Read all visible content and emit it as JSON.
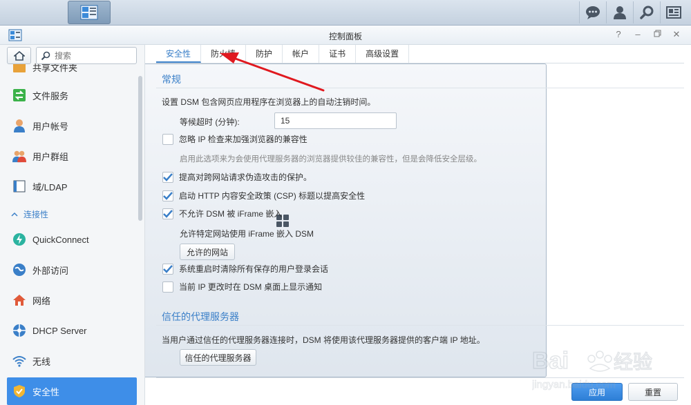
{
  "window": {
    "title": "控制面板"
  },
  "taskbar": {
    "icons": [
      "main-menu-icon",
      "control-panel-icon",
      "chat-icon",
      "user-icon",
      "search-icon",
      "widget-icon"
    ]
  },
  "sidebar": {
    "search_placeholder": "搜索",
    "items": [
      {
        "label": "共享文件夹",
        "icon": "shared-folder-icon"
      },
      {
        "label": "文件服务",
        "icon": "file-services-icon"
      },
      {
        "label": "用户帐号",
        "icon": "user-icon"
      },
      {
        "label": "用户群组",
        "icon": "group-icon"
      },
      {
        "label": "域/LDAP",
        "icon": "domain-icon"
      },
      {
        "label": "QuickConnect",
        "icon": "quickconnect-icon"
      },
      {
        "label": "外部访问",
        "icon": "external-access-icon"
      },
      {
        "label": "网络",
        "icon": "network-icon"
      },
      {
        "label": "DHCP Server",
        "icon": "dhcp-icon"
      },
      {
        "label": "无线",
        "icon": "wireless-icon"
      },
      {
        "label": "安全性",
        "icon": "security-icon"
      }
    ],
    "section_connectivity": "连接性"
  },
  "tabs": [
    "安全性",
    "防火墙",
    "防护",
    "帐户",
    "证书",
    "高级设置"
  ],
  "general": {
    "title": "常规",
    "description": "设置 DSM 包含网页应用程序在浏览器上的自动注销时间。",
    "timeout_label": "等候超时 (分钟):",
    "timeout_value": "15",
    "ignore_ip_label": "忽略 IP 检查来加强浏览器的兼容性",
    "ignore_ip_hint": "启用此选项来为会使用代理服务器的浏览器提供较佳的兼容性，但是会降低安全层级。",
    "csrf_label": "提高对跨网站请求伪造攻击的保护。",
    "csp_label": "启动 HTTP 内容安全政策 (CSP) 标题以提高安全性",
    "iframe_label": "不允许 DSM 被 iFrame 嵌入",
    "iframe_allow_text": "允许特定网站使用 iFrame 嵌入 DSM",
    "allowed_sites_button": "允许的网站",
    "clear_sessions_label": "系统重启时清除所有保存的用户登录会话",
    "ip_notify_label": "当前 IP 更改时在 DSM 桌面上显示通知"
  },
  "checkboxes": {
    "ignore_ip": false,
    "csrf": true,
    "csp": true,
    "iframe": true,
    "clear_sessions": true,
    "ip_notify": false
  },
  "proxy": {
    "title": "信任的代理服务器",
    "description": "当用户通过信任的代理服务器连接时，DSM 将使用该代理服务器提供的客户端 IP 地址。",
    "button": "信任的代理服务器"
  },
  "footer": {
    "apply": "应用",
    "reset": "重置"
  },
  "watermark": {
    "brand": "Baidu经验",
    "url": "jingyan.baidu.com"
  },
  "colors": {
    "accent": "#3e8ee8",
    "annotation": "#e0191f"
  }
}
